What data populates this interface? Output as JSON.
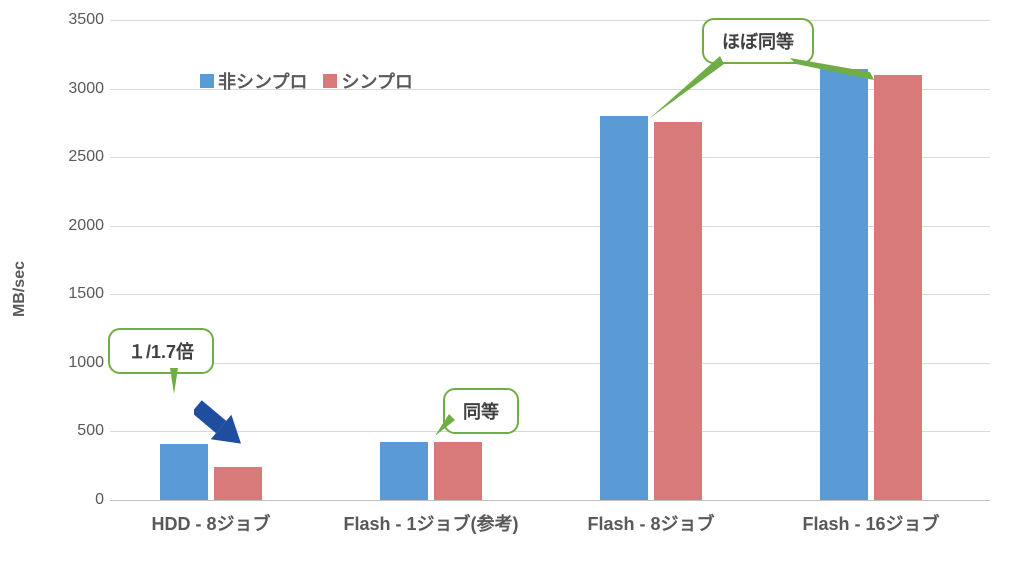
{
  "chart_data": {
    "type": "bar",
    "title": "",
    "xlabel": "",
    "ylabel": "MB/sec",
    "ylim": [
      0,
      3500
    ],
    "yticks": [
      0,
      500,
      1000,
      1500,
      2000,
      2500,
      3000,
      3500
    ],
    "categories": [
      "HDD - 8ジョブ",
      "Flash - 1ジョブ(参考)",
      "Flash - 8ジョブ",
      "Flash - 16ジョブ"
    ],
    "series": [
      {
        "name": "非シンプロ",
        "color": "#5b9bd5",
        "values": [
          410,
          420,
          2800,
          3140
        ]
      },
      {
        "name": "シンプロ",
        "color": "#d77a79",
        "values": [
          240,
          420,
          2760,
          3100
        ]
      }
    ]
  },
  "annotations": {
    "a1": "１/1.7倍",
    "a2": "同等",
    "a3": "ほぼ同等"
  }
}
